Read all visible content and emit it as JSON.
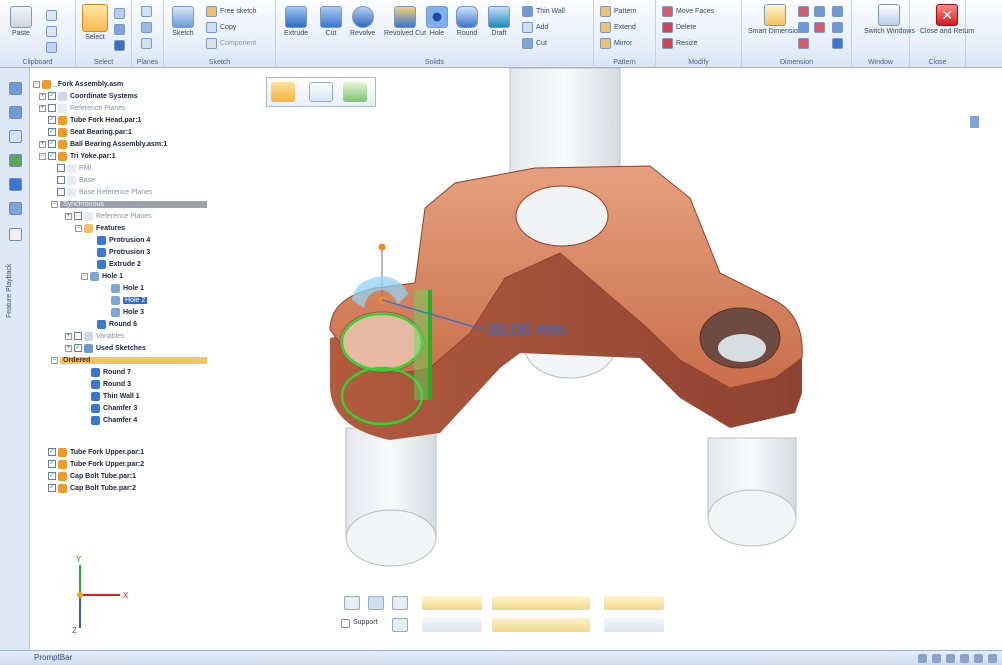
{
  "ribbon": {
    "groups": {
      "clipboard": "Clipboard",
      "select": "Select",
      "planes": "Planes",
      "sketch": "Sketch",
      "solids": "Solids",
      "pattern": "Pattern",
      "modify": "Modify",
      "dimension": "Dimension",
      "window": "Window",
      "close": "Close"
    },
    "buttons": {
      "paste": "Paste",
      "select": "Select",
      "sketch": "Sketch",
      "free_sketch": "Free sketch",
      "copy": "Copy",
      "component": "Component",
      "extrude": "Extrude",
      "cut": "Cut",
      "revolve": "Revolve",
      "revolved_cut": "Revolved Cut",
      "hole": "Hole",
      "round": "Round",
      "draft": "Draft",
      "thin_wall": "Thin Wall",
      "add": "Add",
      "cut_small": "Cut",
      "pattern": "Pattern",
      "extend": "Extend",
      "mirror": "Mirror",
      "move_faces": "Move Faces",
      "delete": "Delete",
      "resize": "Resize",
      "smart_dimension": "Smart Dimension",
      "switch_windows": "Switch Windows",
      "close_and_return": "Close and Return"
    }
  },
  "tree": {
    "items": [
      "_Fork Assembly.asm",
      "Coordinate Systems",
      "Reference Planes",
      "Tube Fork Head.par:1",
      "Seat Bearing.par:1",
      "Ball Bearing Assembly.asm:1",
      "Tri Yoke.par:1",
      "PMI",
      "Base",
      "Base Reference Planes",
      "Synchronous",
      "Reference Planes",
      "Features",
      "Protrusion 4",
      "Protrusion 3",
      "Extrude 2",
      "Hole 1",
      "Hole 1",
      "Hole 2",
      "Hole 3",
      "Round 6",
      "Variables",
      "Used Sketches",
      "Ordered",
      "Round 7",
      "Round 3",
      "Thin Wall 1",
      "Chamfer 3",
      "Chamfer 4",
      "Tube Fork Upper.par:1",
      "Tube Fork Upper.par:2",
      "Cap Bolt Tube.par:1",
      "Cap Bolt Tube.par:2"
    ]
  },
  "side_panel_label": "Feature Playback",
  "viewport": {
    "dimension_value": "30.00 mm",
    "support_label": "Support",
    "axes": {
      "x": "X",
      "y": "Y",
      "z": "Z"
    }
  },
  "status": {
    "text": "PromptBar"
  },
  "colors": {
    "part": "#d9835f",
    "part_dark": "#a4513a",
    "highlight_green": "#2fd42f",
    "dimension_blue": "#2b6fd6",
    "ribbon_blue": "#e6eef9"
  }
}
